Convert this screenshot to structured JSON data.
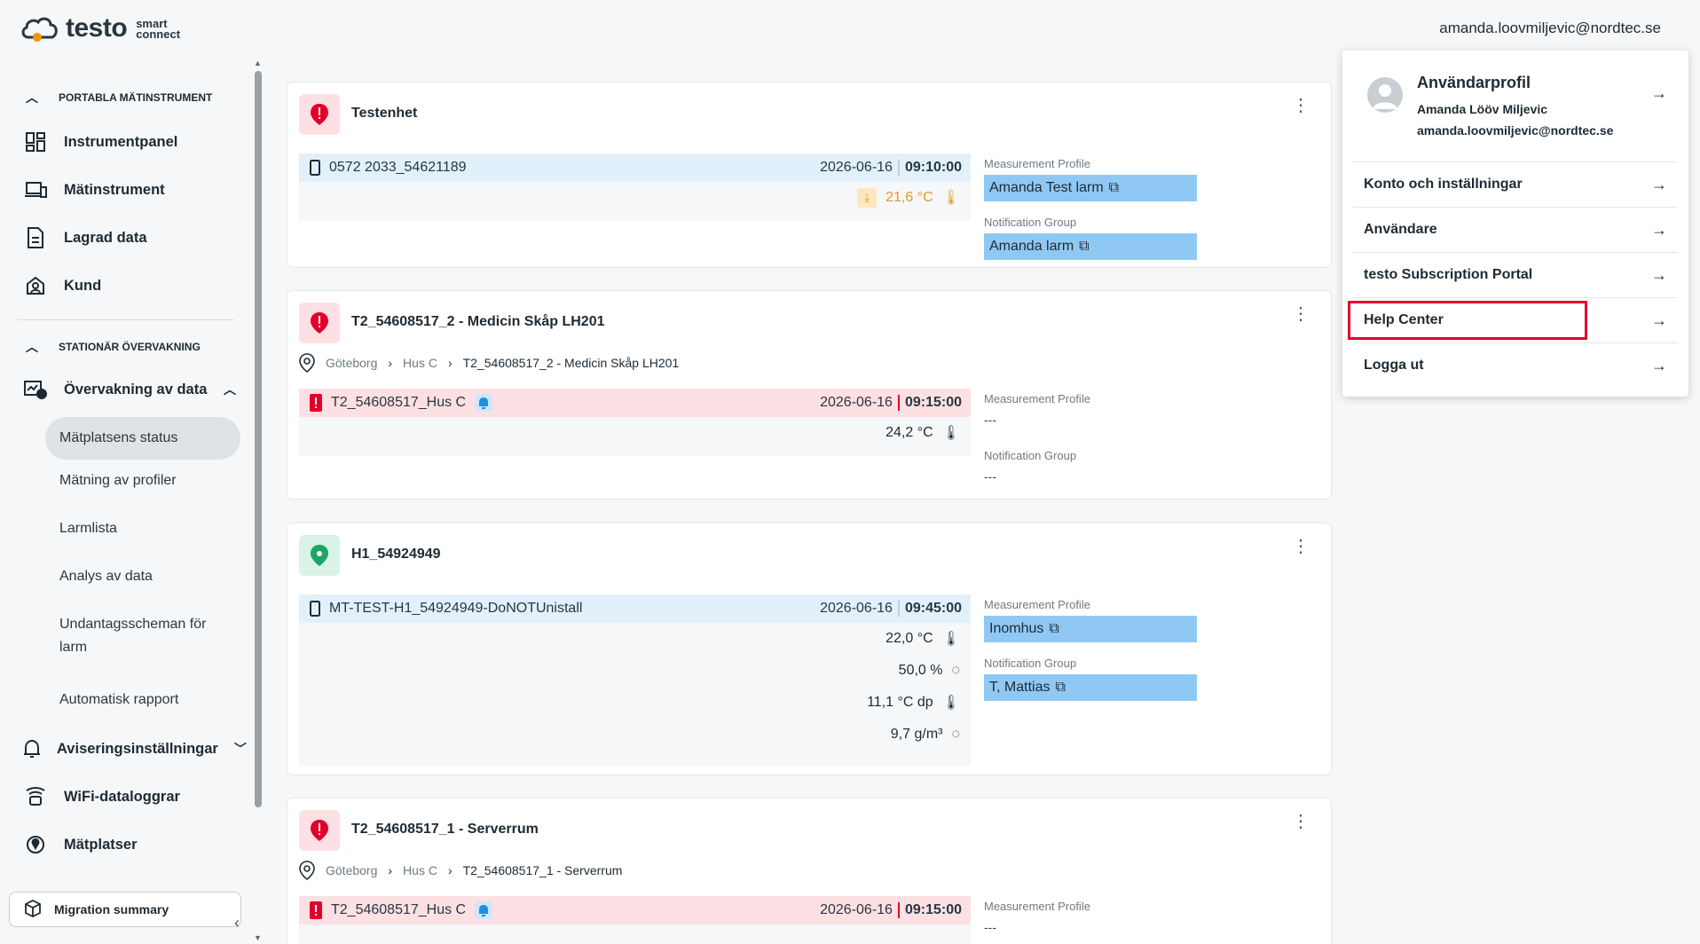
{
  "header": {
    "brand": "testo",
    "brand_sub_1": "smart",
    "brand_sub_2": "connect",
    "user_email": "amanda.loovmiljevic@nordtec.se"
  },
  "sidebar": {
    "section_portable": "PORTABLA MÄTINSTRUMENT",
    "items_portable": [
      "Instrumentpanel",
      "Mätinstrument",
      "Lagrad data",
      "Kund"
    ],
    "section_stationary": "STATIONÄR ÖVERVAKNING",
    "monitoring": "Övervakning av data",
    "monitoring_sub": [
      "Mätplatsens status",
      "Mätning av profiler",
      "Larmlista",
      "Analys av data",
      "Undantagsscheman för larm",
      "Automatisk rapport"
    ],
    "notifications": "Aviseringsinställningar",
    "wifi": "WiFi-dataloggrar",
    "locations": "Mätplatser",
    "migration": "Migration summary"
  },
  "labels": {
    "measurement_profile": "Measurement Profile",
    "notification_group": "Notification Group",
    "none": "---"
  },
  "cards": [
    {
      "title": "Testenhet",
      "device": "0572 2033_54621189",
      "date": "2026-06-16",
      "time": "09:10:00",
      "values": [
        "21,6 °C"
      ],
      "profile": "Amanda Test larm",
      "group": "Amanda larm"
    },
    {
      "title": "T2_54608517_2 - Medicin Skåp LH201",
      "crumbs": [
        "Göteborg",
        "Hus C",
        "T2_54608517_2 - Medicin Skåp LH201"
      ],
      "device": "T2_54608517_Hus C",
      "date": "2026-06-16",
      "time": "09:15:00",
      "values": [
        "24,2 °C"
      ]
    },
    {
      "title": "H1_54924949",
      "device": "MT-TEST-H1_54924949-DoNOTUnistall",
      "date": "2026-06-16",
      "time": "09:45:00",
      "values": [
        "22,0 °C",
        "50,0 %",
        "11,1 °C dp",
        "9,7 g/m³"
      ],
      "profile": "Inomhus",
      "group": "T, Mattias"
    },
    {
      "title": "T2_54608517_1 - Serverrum",
      "crumbs": [
        "Göteborg",
        "Hus C",
        "T2_54608517_1 - Serverrum"
      ],
      "device": "T2_54608517_Hus C",
      "date": "2026-06-16",
      "time": "09:15:00"
    }
  ],
  "user_menu": {
    "profile_title": "Användarprofil",
    "profile_name": "Amanda Lööv Miljevic",
    "profile_email": "amanda.loovmiljevic@nordtec.se",
    "items": [
      "Konto och inställningar",
      "Användare",
      "testo Subscription Portal",
      "Help Center",
      "Logga ut"
    ]
  },
  "colors": {
    "alarm_red": "#e2002a",
    "ok_green": "#1fa463",
    "chip_blue": "#90c8f4",
    "highlight": "#e4002b"
  }
}
